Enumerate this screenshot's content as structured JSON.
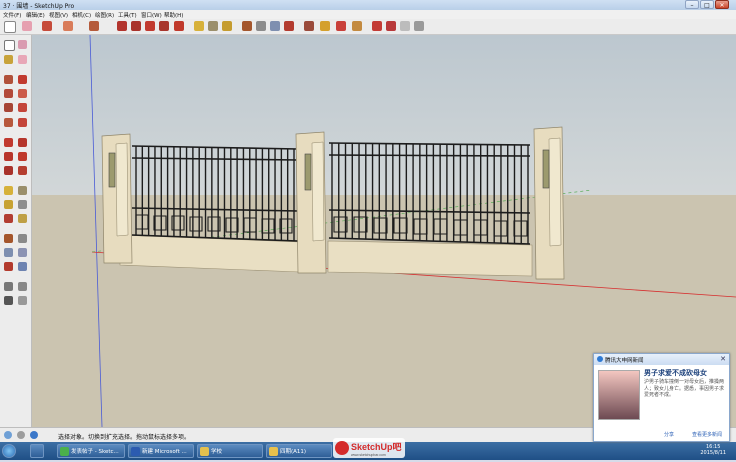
{
  "window": {
    "title": "37 · 围墙 - SketchUp Pro"
  },
  "menu": [
    "文件(F)",
    "编辑(E)",
    "视图(V)",
    "相机(C)",
    "绘图(R)",
    "工具(T)",
    "窗口(W)",
    "帮助(H)"
  ],
  "status": {
    "message": "选择对象。切换到扩充选择。拖动鼠标选择多项。"
  },
  "taskbar": {
    "tasks": [
      {
        "label": "发表帖子 - Sketc..."
      },
      {
        "label": "新建 Microsoft ..."
      },
      {
        "label": "学校"
      },
      {
        "label": "四期(A11)"
      }
    ],
    "clock_time": "16:15",
    "clock_date": "2015/8/11"
  },
  "notification": {
    "header": "腾讯大申网新闻",
    "headline": "男子求爱不成砍母女",
    "body": "沪男子骑车撞倒一对母女后，推搡两人；致女儿身亡。据悉，事因男子求爱死者不成。",
    "share": "分享",
    "more": "查看更多新闻"
  },
  "watermark": {
    "text": "SketchUp吧",
    "sub": "www.sketchupbar.com"
  },
  "colors": {
    "sky": "#c6cfd6",
    "ground": "#cbc4b0",
    "metal": "#1c1c1c",
    "stone": "#e7dcbf",
    "accent": "#d42b2b"
  }
}
